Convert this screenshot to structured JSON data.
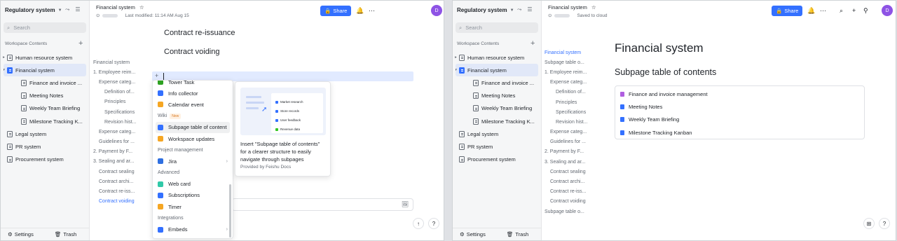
{
  "colors": {
    "accent": "#3370ff",
    "avatar": "#8e53e5",
    "selected_bg": "#e1e8f8"
  },
  "left": {
    "workspace": "Regulatory system",
    "search_placeholder": "Search",
    "workspace_label": "Workspace Contents",
    "tree": [
      {
        "label": "Human resource system",
        "arrow": "▸",
        "indent": 0,
        "active": false,
        "blue": false
      },
      {
        "label": "Financial system",
        "arrow": "▾",
        "indent": 0,
        "active": true,
        "blue": true
      },
      {
        "label": "Finance and invoice ...",
        "arrow": "",
        "indent": 1,
        "active": false,
        "blue": false
      },
      {
        "label": "Meeting Notes",
        "arrow": "",
        "indent": 1,
        "active": false,
        "blue": false
      },
      {
        "label": "Weekly Team Briefing",
        "arrow": "",
        "indent": 1,
        "active": false,
        "blue": false
      },
      {
        "label": "Milestone Tracking K...",
        "arrow": "",
        "indent": 1,
        "active": false,
        "blue": false
      },
      {
        "label": "Legal system",
        "arrow": "",
        "indent": 0,
        "active": false,
        "blue": false
      },
      {
        "label": "PR system",
        "arrow": "",
        "indent": 0,
        "active": false,
        "blue": false
      },
      {
        "label": "Procurement system",
        "arrow": "",
        "indent": 0,
        "active": false,
        "blue": false
      }
    ],
    "settings": "Settings",
    "trash": "Trash",
    "doc_title": "Financial system",
    "doc_status": "Last modified: 11:14 AM Aug 15",
    "share": "Share",
    "avatar": "D",
    "heading1": "Contract re-issuance",
    "heading2": "Contract voiding",
    "outline": [
      {
        "label": "Financial system",
        "level": "l1 muted"
      },
      {
        "label": "1. Employee reim...",
        "level": "l1 muted"
      },
      {
        "label": "Expense categ...",
        "level": "l2"
      },
      {
        "label": "Definition of...",
        "level": "l3"
      },
      {
        "label": "Principles",
        "level": "l3"
      },
      {
        "label": "Specifications",
        "level": "l3"
      },
      {
        "label": "Revision hist...",
        "level": "l3"
      },
      {
        "label": "Expense categ...",
        "level": "l2"
      },
      {
        "label": "Guidelines for ...",
        "level": "l2"
      },
      {
        "label": "2. Payment by F...",
        "level": "l1 muted"
      },
      {
        "label": "3. Sealing and ar...",
        "level": "l1 muted"
      },
      {
        "label": "Contract sealing",
        "level": "l2"
      },
      {
        "label": "Contract archi...",
        "level": "l2"
      },
      {
        "label": "Contract re-iss...",
        "level": "l2"
      },
      {
        "label": "Contract voiding",
        "level": "l2 blue"
      }
    ],
    "popup": {
      "items": [
        {
          "type": "item",
          "label": "Tower Task",
          "icon_color": "#2ea121"
        },
        {
          "type": "item",
          "label": "Info collector",
          "icon_color": "#3370ff"
        },
        {
          "type": "item",
          "label": "Calendar event",
          "icon_color": "#f5a623"
        },
        {
          "type": "section",
          "label": "Wiki",
          "badge": "New"
        },
        {
          "type": "item",
          "label": "Subpage table of content",
          "icon_color": "#3370ff",
          "selected": true
        },
        {
          "type": "item",
          "label": "Workspace updates",
          "icon_color": "#f5a623"
        },
        {
          "type": "section",
          "label": "Project management"
        },
        {
          "type": "item",
          "label": "Jira",
          "icon_color": "#2f6fe0",
          "chevron": true
        },
        {
          "type": "section",
          "label": "Advanced"
        },
        {
          "type": "item",
          "label": "Web card",
          "icon_color": "#30c9a8"
        },
        {
          "type": "item",
          "label": "Subscriptions",
          "icon_color": "#3370ff"
        },
        {
          "type": "item",
          "label": "Timer",
          "icon_color": "#f5a623"
        },
        {
          "type": "section",
          "label": "Integrations"
        },
        {
          "type": "item",
          "label": "Embeds",
          "icon_color": "#3370ff",
          "chevron": true
        }
      ]
    },
    "preview": {
      "rows": [
        {
          "label": "Market research",
          "color": "#3370ff"
        },
        {
          "label": "Store records",
          "color": "#3370ff"
        },
        {
          "label": "User feedback",
          "color": "#3370ff"
        },
        {
          "label": "Revenue data",
          "color": "#34c724"
        }
      ],
      "text": "Insert \"Subpage table of contents\" for a clearer structure to easily navigate through subpages",
      "provider": "Provided by Feishu Docs"
    }
  },
  "right": {
    "workspace": "Regulatory system",
    "search_placeholder": "Search",
    "workspace_label": "Workspace Contents",
    "tree": [
      {
        "label": "Human resource system",
        "arrow": "▸",
        "indent": 0,
        "active": false,
        "blue": false
      },
      {
        "label": "Financial system",
        "arrow": "▾",
        "indent": 0,
        "active": true,
        "blue": true
      },
      {
        "label": "Finance and invoice ...",
        "arrow": "",
        "indent": 1,
        "active": false,
        "blue": false
      },
      {
        "label": "Meeting Notes",
        "arrow": "",
        "indent": 1,
        "active": false,
        "blue": false
      },
      {
        "label": "Weekly Team Briefing",
        "arrow": "",
        "indent": 1,
        "active": false,
        "blue": false
      },
      {
        "label": "Milestone Tracking K...",
        "arrow": "",
        "indent": 1,
        "active": false,
        "blue": false
      },
      {
        "label": "Legal system",
        "arrow": "",
        "indent": 0,
        "active": false,
        "blue": false
      },
      {
        "label": "PR system",
        "arrow": "",
        "indent": 0,
        "active": false,
        "blue": false
      },
      {
        "label": "Procurement system",
        "arrow": "",
        "indent": 0,
        "active": false,
        "blue": false
      }
    ],
    "settings": "Settings",
    "trash": "Trash",
    "doc_title": "Financial system",
    "doc_status": "Saved to cloud",
    "share": "Share",
    "avatar": "D",
    "page_title": "Financial system",
    "subpage_title": "Subpage table of contents",
    "toc": [
      {
        "label": "Finance and invoice management",
        "color": "#b05ee0"
      },
      {
        "label": "Meeting Notes",
        "color": "#3370ff"
      },
      {
        "label": "Weekly Team Briefing",
        "color": "#3370ff"
      },
      {
        "label": "Milestone Tracking Kanban",
        "color": "#3370ff"
      }
    ],
    "outline": [
      {
        "label": "Financial system",
        "level": "l1 blue"
      },
      {
        "label": "Subpage table o...",
        "level": "l1 muted"
      },
      {
        "label": "1. Employee reim...",
        "level": "l1 muted"
      },
      {
        "label": "Expense categ...",
        "level": "l2"
      },
      {
        "label": "Definition of...",
        "level": "l3"
      },
      {
        "label": "Principles",
        "level": "l3"
      },
      {
        "label": "Specifications",
        "level": "l3"
      },
      {
        "label": "Revision hist...",
        "level": "l3"
      },
      {
        "label": "Expense categ...",
        "level": "l2"
      },
      {
        "label": "Guidelines for ...",
        "level": "l2"
      },
      {
        "label": "2. Payment by F...",
        "level": "l1 muted"
      },
      {
        "label": "3. Sealing and ar...",
        "level": "l1 muted"
      },
      {
        "label": "Contract sealing",
        "level": "l2"
      },
      {
        "label": "Contract archi...",
        "level": "l2"
      },
      {
        "label": "Contract re-iss...",
        "level": "l2"
      },
      {
        "label": "Contract voiding",
        "level": "l2"
      },
      {
        "label": "Subpage table o...",
        "level": "l1 muted"
      }
    ]
  }
}
